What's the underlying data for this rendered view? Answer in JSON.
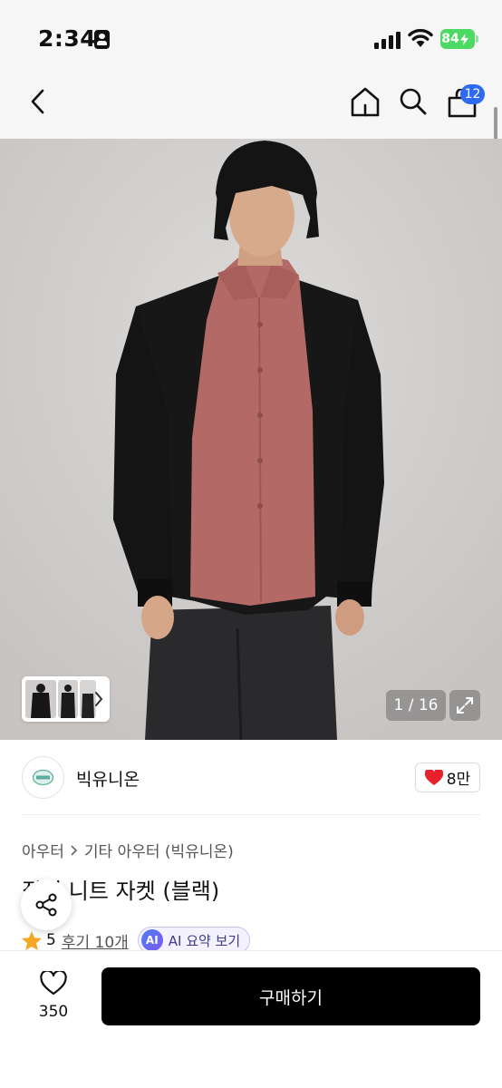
{
  "status_bar": {
    "time": "2:34",
    "battery": "84"
  },
  "nav": {
    "cart_count": "12",
    "icons": [
      "back-icon",
      "home-icon",
      "search-icon",
      "cart-icon"
    ]
  },
  "gallery": {
    "page_indicator": "1 / 16",
    "icons": [
      "chevron-right-icon",
      "expand-icon"
    ]
  },
  "brand": {
    "name": "빅유니온",
    "like_count": "8만"
  },
  "product": {
    "breadcrumb": [
      "아우터",
      "기타 아우터 (빅유니온)"
    ],
    "title": "집업 니트 자켓 (블랙)",
    "rating": "5",
    "review_link": "후기 10개",
    "ai_badge": "AI",
    "ai_summary": "AI 요약 보기"
  },
  "bottom_bar": {
    "wish_count": "350",
    "buy_label": "구매하기"
  },
  "colors": {
    "accent_blue": "#2f6bf2",
    "heart_red": "#e8202a",
    "star_orange": "#f5a623",
    "buy_button": "#000000",
    "battery_green": "#4cd964"
  }
}
